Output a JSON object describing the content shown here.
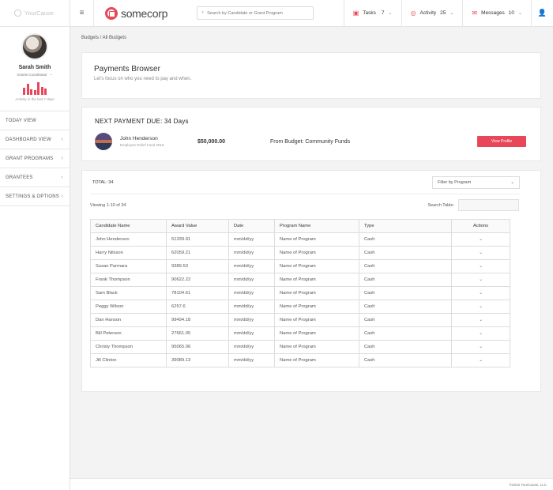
{
  "brand": {
    "name": "YourCause"
  },
  "sidebar": {
    "profile": {
      "name": "Sarah Smith",
      "role": "Grants Coordinator",
      "activity_caption": "Activity in the last 7 days",
      "activity_bars": [
        0.55,
        0.85,
        0.45,
        0.4,
        1.0,
        0.6,
        0.5
      ]
    },
    "items": [
      {
        "label": "TODAY VIEW",
        "chevron": ""
      },
      {
        "label": "DASHBOARD VIEW",
        "chevron": "‹"
      },
      {
        "label": "GRANT PROGRAMS",
        "chevron": "‹"
      },
      {
        "label": "GRANTEES",
        "chevron": "‹"
      },
      {
        "label": "SETTINGS & OPTIONS",
        "chevron": "‹"
      }
    ]
  },
  "topbar": {
    "logo_text": "somecorp",
    "search_placeholder": "Search by Candidate or Grant Program",
    "tasks": {
      "label": "Tasks",
      "count": "7"
    },
    "activity": {
      "label": "Activity",
      "count": "25"
    },
    "messages": {
      "label": "Messages",
      "count": "10"
    }
  },
  "breadcrumb": "Budgets  /  All Budgets",
  "browser": {
    "title": "Payments Browser",
    "subtitle": "Let's focus on who you need to pay and when."
  },
  "next_payment": {
    "heading": "NEXT PAYMENT DUE: 34 Days",
    "name": "John Henderson",
    "fund": "Employee Relief Fund 2016",
    "amount": "$50,000.00",
    "budget": "From Budget: Community Funds",
    "button": "View Profile"
  },
  "table": {
    "total": "TOTAL: 34",
    "filter": "Filter by Program",
    "viewing": "Viewing 1-10 of 34",
    "search_label": "Search Table:",
    "headers": [
      "Candidate Name",
      "Award Value",
      "Date",
      "Program Name",
      "Type",
      "Actions"
    ],
    "rows": [
      [
        "John Henderson",
        "51339.91",
        "mm/dd/yy",
        "Name of Program",
        "Cash",
        "⌄"
      ],
      [
        "Harry Nilsson",
        "62059.21",
        "mm/dd/yy",
        "Name of Program",
        "Cash",
        "⌄"
      ],
      [
        "Susan Parmara",
        "9389.53",
        "mm/dd/yy",
        "Name of Program",
        "Cash",
        "⌄"
      ],
      [
        "Frank Thompson",
        "90622.22",
        "mm/dd/yy",
        "Name of Program",
        "Cash",
        "⌄"
      ],
      [
        "Sam Black",
        "78104.61",
        "mm/dd/yy",
        "Name of Program",
        "Cash",
        "⌄"
      ],
      [
        "Peggy Wilson",
        "6257.6",
        "mm/dd/yy",
        "Name of Program",
        "Cash",
        "⌄"
      ],
      [
        "Dan Hanson",
        "99494.18",
        "mm/dd/yy",
        "Name of Program",
        "Cash",
        "⌄"
      ],
      [
        "Bill Peterson",
        "27661.05",
        "mm/dd/yy",
        "Name of Program",
        "Cash",
        "⌄"
      ],
      [
        "Christy Thompson",
        "95065.06",
        "mm/dd/yy",
        "Name of Program",
        "Cash",
        "⌄"
      ],
      [
        "Jill Clinton",
        "39089.13",
        "mm/dd/yy",
        "Name of Program",
        "Cash",
        "⌄"
      ]
    ]
  },
  "footer": "©2016 YourCause, LLC",
  "colors": {
    "accent": "#e8475a"
  },
  "icons": {
    "menu": "hamburger-icon",
    "search": "search-icon",
    "tasks": "tasks-icon",
    "activity": "activity-icon",
    "messages": "mail-icon",
    "user": "user-icon"
  }
}
